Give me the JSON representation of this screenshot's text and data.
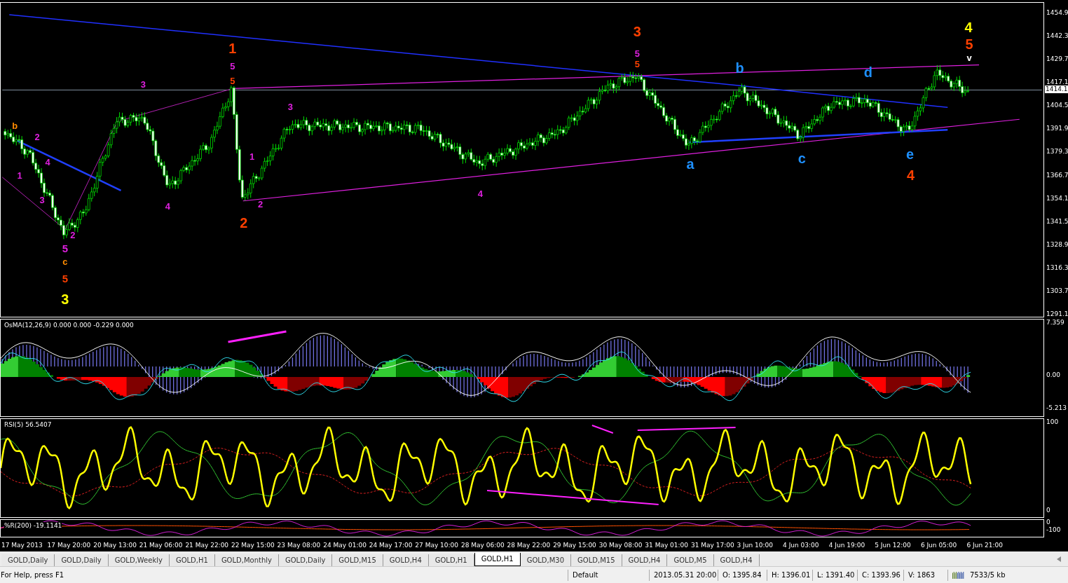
{
  "price_axis": {
    "ticks": [
      "1454.9",
      "1442.3",
      "1429.7",
      "1417.1",
      "1404.5",
      "1391.9",
      "1379.3",
      "1366.7",
      "1354.1",
      "1341.5",
      "1328.9",
      "1316.3",
      "1303.7",
      "1291.1"
    ],
    "current": "1414.1"
  },
  "wave_labels": [
    {
      "text": "1",
      "kind": "big",
      "color": "#ff4000"
    },
    {
      "text": "5",
      "kind": "small",
      "color": "#e020e0"
    },
    {
      "text": "5",
      "kind": "small",
      "color": "#ff4000"
    },
    {
      "text": "2",
      "kind": "big",
      "color": "#ff4000"
    },
    {
      "text": "3",
      "kind": "big",
      "color": "#ff4000"
    },
    {
      "text": "5",
      "kind": "small",
      "color": "#e020e0"
    },
    {
      "text": "5",
      "kind": "small",
      "color": "#ff4000"
    },
    {
      "text": "4",
      "kind": "big",
      "color": "#ffff00"
    },
    {
      "text": "5",
      "kind": "big",
      "color": "#ff4000"
    },
    {
      "text": "v",
      "kind": "small",
      "color": "#ffffff"
    },
    {
      "text": "b",
      "kind": "big",
      "color": "#1e90ff"
    },
    {
      "text": "d",
      "kind": "big",
      "color": "#1e90ff"
    },
    {
      "text": "a",
      "kind": "big",
      "color": "#1e90ff"
    },
    {
      "text": "c",
      "kind": "big",
      "color": "#1e90ff"
    },
    {
      "text": "e",
      "kind": "big",
      "color": "#1e90ff"
    },
    {
      "text": "4",
      "kind": "big",
      "color": "#ff4000"
    },
    {
      "text": "5",
      "kind": "medium",
      "color": "#e020e0"
    },
    {
      "text": "c",
      "kind": "small",
      "color": "#ff8c00"
    },
    {
      "text": "5",
      "kind": "medium",
      "color": "#ff4000"
    },
    {
      "text": "3",
      "kind": "big",
      "color": "#ffff00"
    },
    {
      "text": "3",
      "kind": "small",
      "color": "#e020e0"
    },
    {
      "text": "2",
      "kind": "small",
      "color": "#e020e0"
    },
    {
      "text": "1",
      "kind": "small",
      "color": "#e020e0"
    },
    {
      "text": "2",
      "kind": "small",
      "color": "#e020e0"
    },
    {
      "text": "3",
      "kind": "small",
      "color": "#e020e0"
    },
    {
      "text": "4",
      "kind": "small",
      "color": "#e020e0"
    },
    {
      "text": "4",
      "kind": "small",
      "color": "#e020e0"
    },
    {
      "text": "b",
      "kind": "small",
      "color": "#ff8c00"
    },
    {
      "text": "1",
      "kind": "small",
      "color": "#e020e0"
    },
    {
      "text": "4",
      "kind": "small",
      "color": "#e020e0"
    },
    {
      "text": "3",
      "kind": "small",
      "color": "#e020e0"
    },
    {
      "text": "2",
      "kind": "small",
      "color": "#e020e0"
    }
  ],
  "osma": {
    "label": "OsMA(12,26,9) 0.000 0.000 -0.229 0.000",
    "ticks": [
      "7.359",
      "0.00",
      "-5.213"
    ]
  },
  "rsi": {
    "label": "RSI(5) 56.5407",
    "ticks": [
      "100",
      "0"
    ]
  },
  "williams_r": {
    "label": "%R(200) -19.1141",
    "ticks": [
      "0",
      "-100"
    ]
  },
  "time_axis": [
    "17 May 2013",
    "17 May 20:00",
    "20 May 13:00",
    "21 May 06:00",
    "21 May 22:00",
    "22 May 15:00",
    "23 May 08:00",
    "24 May 01:00",
    "24 May 17:00",
    "27 May 10:00",
    "28 May 06:00",
    "28 May 22:00",
    "29 May 15:00",
    "30 May 08:00",
    "31 May 01:00",
    "31 May 17:00",
    "3 Jun 10:00",
    "4 Jun 03:00",
    "4 Jun 19:00",
    "5 Jun 12:00",
    "6 Jun 05:00",
    "6 Jun 21:00"
  ],
  "tabs": [
    {
      "label": "GOLD,Daily",
      "selected": false
    },
    {
      "label": "GOLD,Daily",
      "selected": false
    },
    {
      "label": "GOLD,Weekly",
      "selected": false
    },
    {
      "label": "GOLD,H1",
      "selected": false
    },
    {
      "label": "GOLD,Monthly",
      "selected": false
    },
    {
      "label": "GOLD,Daily",
      "selected": false
    },
    {
      "label": "GOLD,M15",
      "selected": false
    },
    {
      "label": "GOLD,H4",
      "selected": false
    },
    {
      "label": "GOLD,H1",
      "selected": false
    },
    {
      "label": "GOLD,H1",
      "selected": true
    },
    {
      "label": "GOLD,M30",
      "selected": false
    },
    {
      "label": "GOLD,M15",
      "selected": false
    },
    {
      "label": "GOLD,H4",
      "selected": false
    },
    {
      "label": "GOLD,M5",
      "selected": false
    },
    {
      "label": "GOLD,H4",
      "selected": false
    }
  ],
  "status_bar": {
    "help": "For Help, press F1",
    "profile": "Default",
    "time": "2013.05.31 20:00",
    "open": "O: 1395.84",
    "high": "H: 1396.01",
    "low": "L: 1391.40",
    "close": "C: 1393.96",
    "volume": "V: 1863",
    "traffic": "7533/5 kb"
  }
}
